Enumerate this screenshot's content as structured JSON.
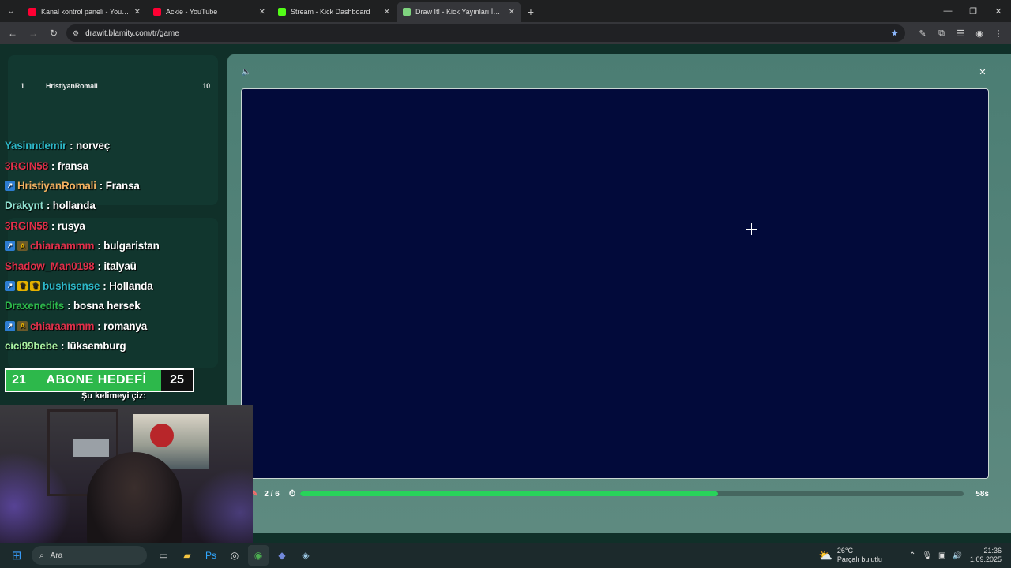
{
  "browser": {
    "tabs": [
      {
        "title": "Kanal kontrol paneli - YouTube",
        "favicon_color": "#ff0033",
        "active": false
      },
      {
        "title": "Ackie - YouTube",
        "favicon_color": "#ff0033",
        "active": false
      },
      {
        "title": "Stream - Kick Dashboard",
        "favicon_color": "#53fc18",
        "active": false
      },
      {
        "title": "Draw It! - Kick Yayınları İçin Çizim",
        "favicon_color": "#7fd47f",
        "active": true
      }
    ],
    "url": "drawit.blamity.com/tr/game"
  },
  "leaderboard": {
    "rows": [
      {
        "rank": "1",
        "name": "HristiyanRomali",
        "score": "10"
      }
    ]
  },
  "chat": [
    {
      "user": "Yasinndemir",
      "user_color": "#2db8c8",
      "message": ": norveç",
      "badges": []
    },
    {
      "user": "3RGIN58",
      "user_color": "#e0304a",
      "message": ": fransa",
      "badges": []
    },
    {
      "user": "HristiyanRomali",
      "user_color": "#f0b060",
      "message": ": Fransa",
      "badges": [
        "blue"
      ]
    },
    {
      "user": "Drakynt",
      "user_color": "#8fe0d0",
      "message": ": hollanda",
      "badges": []
    },
    {
      "user": "3RGIN58",
      "user_color": "#e0304a",
      "message": ": rusya",
      "badges": []
    },
    {
      "user": "chiaraammm",
      "user_color": "#e0304a",
      "message": ": bulgaristan",
      "badges": [
        "blue",
        "amber"
      ]
    },
    {
      "user": "Shadow_Man0198",
      "user_color": "#e0304a",
      "message": ": italyaü",
      "badges": []
    },
    {
      "user": "bushisense",
      "user_color": "#2db8c8",
      "message": ": Hollanda",
      "badges": [
        "blue",
        "yellow",
        "yellow"
      ]
    },
    {
      "user": "Draxenedits",
      "user_color": "#2db84b",
      "message": ": bosna hersek",
      "badges": []
    },
    {
      "user": "chiaraammm",
      "user_color": "#e0304a",
      "message": ": romanya",
      "badges": [
        "blue",
        "amber"
      ]
    },
    {
      "user": "cici99bebe",
      "user_color": "#a8f0a0",
      "message": ": lüksemburg",
      "badges": []
    }
  ],
  "goal": {
    "start": "21",
    "label": "ABONE HEDEFİ",
    "end": "25"
  },
  "draw_word_label": "Şu kelimeyi çiz:",
  "game": {
    "round": "2 / 6",
    "progress_fraction": 0.63,
    "seconds": "58s",
    "canvas_color": "#020a3a"
  },
  "taskbar": {
    "search_placeholder": "Ara",
    "weather_temp": "26°C",
    "weather_desc": "Parçalı bulutlu",
    "time": "21:36",
    "date": "1.09.2025"
  }
}
